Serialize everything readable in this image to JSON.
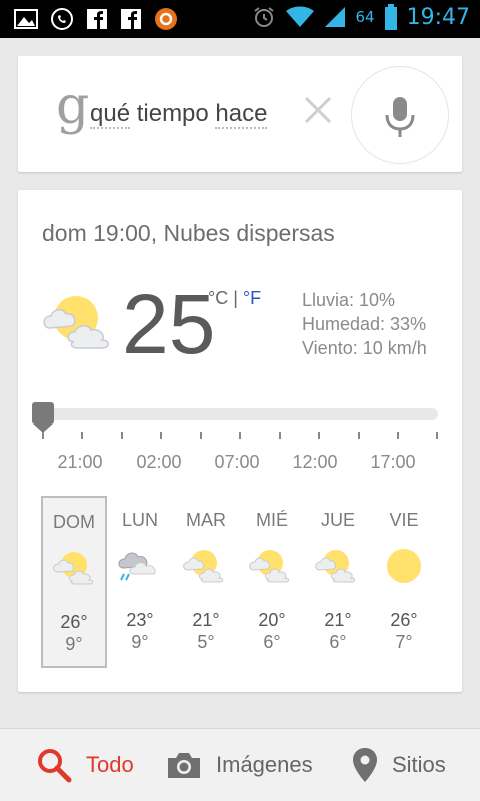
{
  "status_bar": {
    "battery_level": "64",
    "time": "19:47",
    "left_icons": [
      "gallery-icon",
      "whatsapp-icon",
      "facebook-icon",
      "facebook-icon",
      "app-icon"
    ],
    "right_icons": [
      "alarm-icon",
      "wifi-icon",
      "signal-icon",
      "battery-icon"
    ]
  },
  "search": {
    "query_parts": [
      "qué",
      " tiempo ",
      "hace"
    ],
    "google_letter": "g"
  },
  "weather": {
    "heading": "dom 19:00, Nubes dispersas",
    "temperature": "25",
    "unit_c": "°C",
    "unit_sep": " | ",
    "unit_f": "°F",
    "rain": "Lluvia: 10%",
    "humidity": "Humedad: 33%",
    "wind": "Viento: 10 km/h",
    "hour_labels": [
      "21:00",
      "02:00",
      "07:00",
      "12:00",
      "17:00"
    ],
    "slider_position": 0,
    "days": [
      {
        "name": "DOM",
        "hi": "26°",
        "lo": "9°",
        "icon": "partly-cloudy-icon",
        "selected": true
      },
      {
        "name": "LUN",
        "hi": "23°",
        "lo": "9°",
        "icon": "rain-cloud-icon",
        "selected": false
      },
      {
        "name": "MAR",
        "hi": "21°",
        "lo": "5°",
        "icon": "partly-cloudy-icon",
        "selected": false
      },
      {
        "name": "MIÉ",
        "hi": "20°",
        "lo": "6°",
        "icon": "partly-cloudy-icon",
        "selected": false
      },
      {
        "name": "JUE",
        "hi": "21°",
        "lo": "6°",
        "icon": "partly-cloudy-icon",
        "selected": false
      },
      {
        "name": "VIE",
        "hi": "26°",
        "lo": "7°",
        "icon": "sun-icon",
        "selected": false
      }
    ]
  },
  "bottom_tabs": [
    {
      "label": "Todo",
      "icon": "search-icon",
      "active": true
    },
    {
      "label": "Imágenes",
      "icon": "camera-icon",
      "active": false
    },
    {
      "label": "Sitios",
      "icon": "location-pin-icon",
      "active": false
    }
  ],
  "colors": {
    "accent_blue": "#33b5e5",
    "active_red": "#e0392b",
    "unit_link_blue": "#2a54c8",
    "sun_yellow": "#ffe16b"
  }
}
